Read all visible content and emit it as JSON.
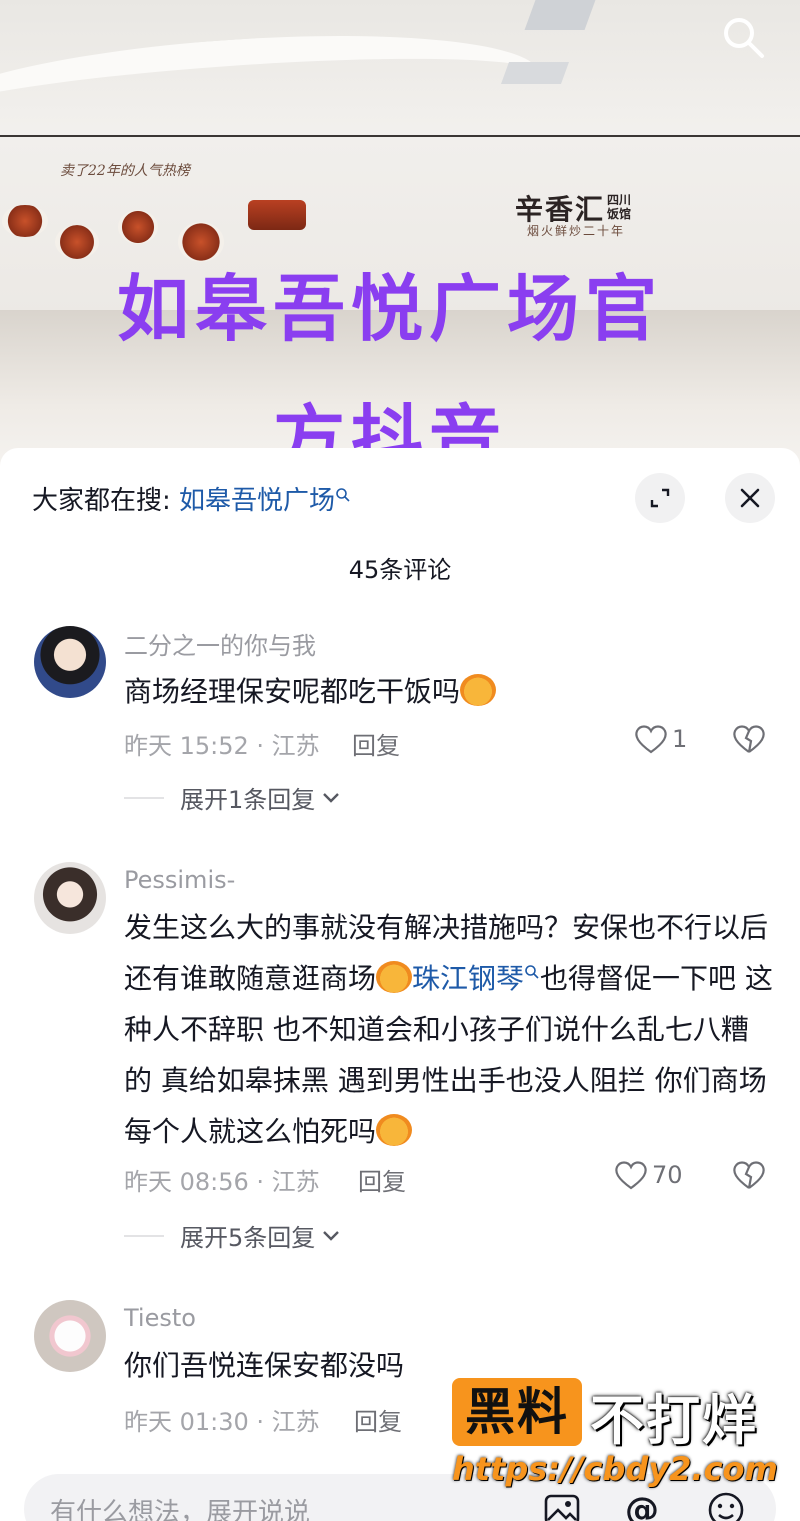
{
  "video": {
    "overlay_line1": "如皋吾悦广场官",
    "overlay_line2": "方抖音",
    "menu_text": "卖了22年的人气热榜",
    "brand_name": "辛香汇",
    "brand_badge": "四川饭馆",
    "brand_sub": "烟火鲜炒二十年",
    "search_icon": "search-icon"
  },
  "sheet": {
    "hot_search_prefix": "大家都在搜: ",
    "hot_search_link": "如皋吾悦广场",
    "comment_count": "45条评论"
  },
  "comments": [
    {
      "username": "二分之一的你与我",
      "text": "商场经理保安呢都吃干饭吗",
      "time_location": "昨天 15:52 · 江苏",
      "reply_label": "回复",
      "likes": "1",
      "expand_label": "展开1条回复"
    },
    {
      "username": "Pessimis-",
      "text_part1": "发生这么大的事就没有解决措施吗？安保也不行以后还有谁敢随意逛商场",
      "text_link": "珠江钢琴",
      "text_part2": "也得督促一下吧 这种人不辞职 也不知道会和小孩子们说什么乱七八糟的 真给如皋抹黑 遇到男性出手也没人阻拦 你们商场每个人就这么怕死吗",
      "time_location": "昨天 08:56 · 江苏",
      "reply_label": "回复",
      "likes": "70",
      "expand_label": "展开5条回复"
    },
    {
      "username": "Tiesto",
      "text": "你们吾悦连保安都没吗",
      "time_location": "昨天 01:30 · 江苏",
      "reply_label": "回复"
    }
  ],
  "input": {
    "placeholder": "有什么想法，展开说说"
  },
  "watermark": {
    "box_text": "黑料",
    "text": "不打烊",
    "url": "https://cbdy2.com"
  },
  "colors": {
    "overlay_purple": "#8a3ef0",
    "link_blue": "#1e5aa8",
    "watermark_orange": "#f7941d"
  }
}
